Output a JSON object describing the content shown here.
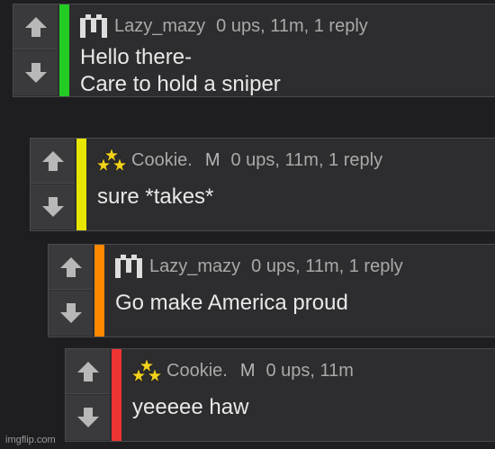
{
  "comments": [
    {
      "username": "Lazy_mazy",
      "is_mod": false,
      "meta": "0 ups, 11m, 1 reply",
      "lines": [
        "Hello there-",
        "Care to hold a sniper"
      ],
      "bar_color": "#22cc22",
      "avatar_icon": "pixel-m-avatar-icon"
    },
    {
      "username": "Cookie.",
      "is_mod": true,
      "mod_label": "M",
      "meta": "0 ups, 11m, 1 reply",
      "lines": [
        "sure *takes*"
      ],
      "bar_color": "#e6e600",
      "avatar_icon": "three-stars-avatar-icon"
    },
    {
      "username": "Lazy_mazy",
      "is_mod": false,
      "meta": "0 ups, 11m, 1 reply",
      "lines": [
        "Go make America proud"
      ],
      "bar_color": "#ff8800",
      "avatar_icon": "pixel-m-avatar-icon"
    },
    {
      "username": "Cookie.",
      "is_mod": true,
      "mod_label": "M",
      "meta": "0 ups, 11m",
      "lines": [
        "yeeeee haw"
      ],
      "bar_color": "#ee3333",
      "avatar_icon": "three-stars-avatar-icon"
    }
  ],
  "watermark": "imgflip.com"
}
